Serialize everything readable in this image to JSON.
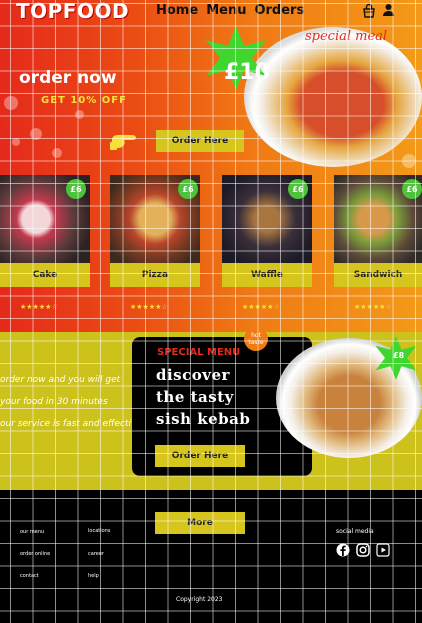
{
  "header": {
    "logo": "TOPFOOD",
    "nav": [
      "Home",
      "Menu",
      "Orders"
    ],
    "icons": [
      "cart-icon",
      "user-icon"
    ]
  },
  "hero": {
    "headline": "order now",
    "offer": "GET 10% OFF",
    "order_button": "Order Here",
    "price": "£10",
    "plate_text": "special meal"
  },
  "products": [
    {
      "name": "Cake",
      "badge": "£6",
      "rating": 4
    },
    {
      "name": "Pizza",
      "badge": "£6",
      "rating": 4
    },
    {
      "name": "Waffle",
      "badge": "£6",
      "rating": 4
    },
    {
      "name": "Sandwich",
      "badge": "£6",
      "rating": 4
    }
  ],
  "promo": {
    "lines": [
      "order now and you will get",
      "your food in 30 minutes",
      "our service is fast and effective"
    ],
    "hot_badge": "hot taste",
    "special_menu": "SPECIAL MENU",
    "title_lines": [
      "discover",
      "the tasty",
      "sish kebab"
    ],
    "order_button": "Order Here",
    "plate_badge": "£8"
  },
  "footer": {
    "more_button": "More",
    "col1": [
      "our menu",
      "order online",
      "contact"
    ],
    "col2": [
      "locations",
      "career",
      "help"
    ],
    "social_title": "social media",
    "social_icons": [
      "facebook-icon",
      "instagram-icon",
      "youtube-icon"
    ],
    "copyright": "Copyright 2023"
  },
  "colors": {
    "hero_start": "#e52a1c",
    "hero_end": "#f39a18",
    "accent_yellow": "#d6c51c",
    "badge_green": "#4cc33a",
    "black": "#000000"
  }
}
